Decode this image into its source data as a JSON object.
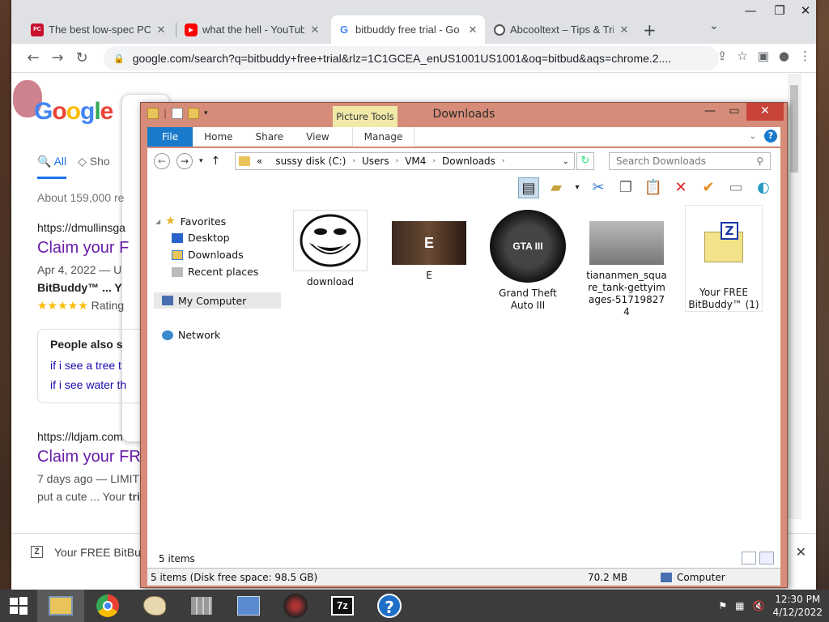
{
  "browser": {
    "tabs": [
      {
        "title": "The best low-spec PC g",
        "icon": "pc-gamer-icon"
      },
      {
        "title": "what the hell - YouTube",
        "icon": "youtube-icon"
      },
      {
        "title": "bitbuddy free trial - Go",
        "icon": "google-icon",
        "active": true
      },
      {
        "title": "Abcooltext – Tips & Tric",
        "icon": "globe-icon"
      }
    ],
    "url": "google.com/search?q=bitbuddy+free+trial&rlz=1C1GCEA_enUS1001US1001&oq=bitbud&aqs=chrome.2...."
  },
  "google": {
    "logo": "Google",
    "tab_all": "All",
    "tab_shop": "Sho",
    "stats": "About 159,000 re",
    "result1": {
      "url": "https://dmullinsga",
      "title": "Claim your F",
      "date": "Apr 4, 2022 — U",
      "snippet": "BitBuddy™ ... Y",
      "rating_stars": "★★★★★",
      "rating_label": "Rating"
    },
    "paa": {
      "heading": "People also s",
      "q1": "if i see a tree t",
      "q2": "if i see water th"
    },
    "result2": {
      "url": "https://ldjam.com",
      "title": "Claim your FR",
      "date": "7 days ago — LIMIT",
      "snippet_pre": "put a cute ... Your ",
      "snippet_bold": "tri"
    }
  },
  "download_bar": {
    "filename": "Your FREE BitBuddy"
  },
  "explorer": {
    "title": "Downloads",
    "picture_tools": "Picture Tools",
    "ribbon_tabs": [
      "File",
      "Home",
      "Share",
      "View",
      "Manage"
    ],
    "address": {
      "prefix": "«",
      "crumbs": [
        "sussy disk (C:)",
        "Users",
        "VM4",
        "Downloads"
      ]
    },
    "search_placeholder": "Search Downloads",
    "nav": {
      "favorites": "Favorites",
      "desktop": "Desktop",
      "downloads": "Downloads",
      "recent": "Recent places",
      "my_computer": "My Computer",
      "network": "Network"
    },
    "files": [
      {
        "name": "download",
        "kind": "troll-face-image"
      },
      {
        "name": "E",
        "kind": "meme-image"
      },
      {
        "name": "Grand Theft Auto III",
        "kind": "gta3-icon"
      },
      {
        "name": "tiananmen_square_tank-gettyimages-517198274",
        "kind": "photo-image"
      },
      {
        "name": "Your FREE BitBuddy™ (1)",
        "kind": "7zip-archive-icon"
      }
    ],
    "status_items": "5 items",
    "status_bar": {
      "items_free": "5 items (Disk free space: 98.5 GB)",
      "size": "70.2 MB",
      "location": "Computer"
    }
  },
  "taskbar": {
    "time": "12:30 PM",
    "date": "4/12/2022"
  },
  "colors": {
    "explorer_frame": "#d68c78",
    "file_tab": "#1979ca",
    "google_visited": "#681da8",
    "taskbar": "#3c3c3c"
  }
}
